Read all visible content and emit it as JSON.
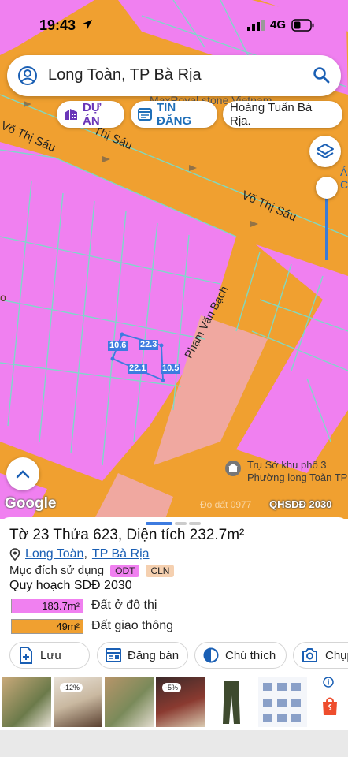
{
  "status_bar": {
    "time": "19:43",
    "network": "4G"
  },
  "search": {
    "query": "Long Toàn, TP Bà Rịa"
  },
  "chips": {
    "du_an": "DỰ ÁN",
    "tin_dang": "TIN ĐĂNG",
    "user": "Hoàng Tuấn Bà Rịa."
  },
  "map": {
    "labels": {
      "maxroyal": "MaxRoyal stone Vietnam",
      "vo_thi_sau_1": "Võ Thị Sáu",
      "vo_thi_sau_2": "Thị Sáu",
      "vo_thi_sau_3": "Võ Thị Sáu",
      "pham_van_bach": "Phạm Văn Bạch",
      "poi_line1": "Trụ Sở khu phố 3",
      "poi_line2": "Phường long Toàn TP",
      "edge_a": "Á",
      "edge_c": "C",
      "edge_o": "o"
    },
    "dimensions": {
      "left": "10.6",
      "top": "22.3",
      "bottom": "22.1",
      "right": "10.5"
    },
    "attribution": "Google",
    "watermark": "Đo đất 0977",
    "layer_badge": "QHSDĐ 2030",
    "colors": {
      "residential": "#f080f0",
      "transport": "#f0a030",
      "public": "#f0a8a0",
      "parcel_line": "#7adcc8"
    }
  },
  "sheet": {
    "title": "Tờ 23 Thửa 623, Diện tích 232.7m²",
    "address": {
      "ward": "Long Toàn",
      "separator": ",",
      "city": "TP Bà Rịa"
    },
    "purpose_label": "Mục đích sử dụng",
    "tags": [
      {
        "code": "ODT",
        "color": "#f080f0"
      },
      {
        "code": "CLN",
        "color": "#f5d0b0"
      }
    ],
    "plan_title": "Quy hoạch SDĐ 2030",
    "legend": [
      {
        "area": "183.7m²",
        "label": "Đất ở đô thị",
        "color": "#f080f0"
      },
      {
        "area": "49m²",
        "label": "Đất giao thông",
        "color": "#f0a030"
      }
    ],
    "actions": {
      "save": "Lưu",
      "post": "Đăng bán",
      "note": "Chú thích",
      "capture": "Chụp"
    }
  },
  "products": {
    "discounts": [
      "-12%",
      "-5%"
    ]
  }
}
